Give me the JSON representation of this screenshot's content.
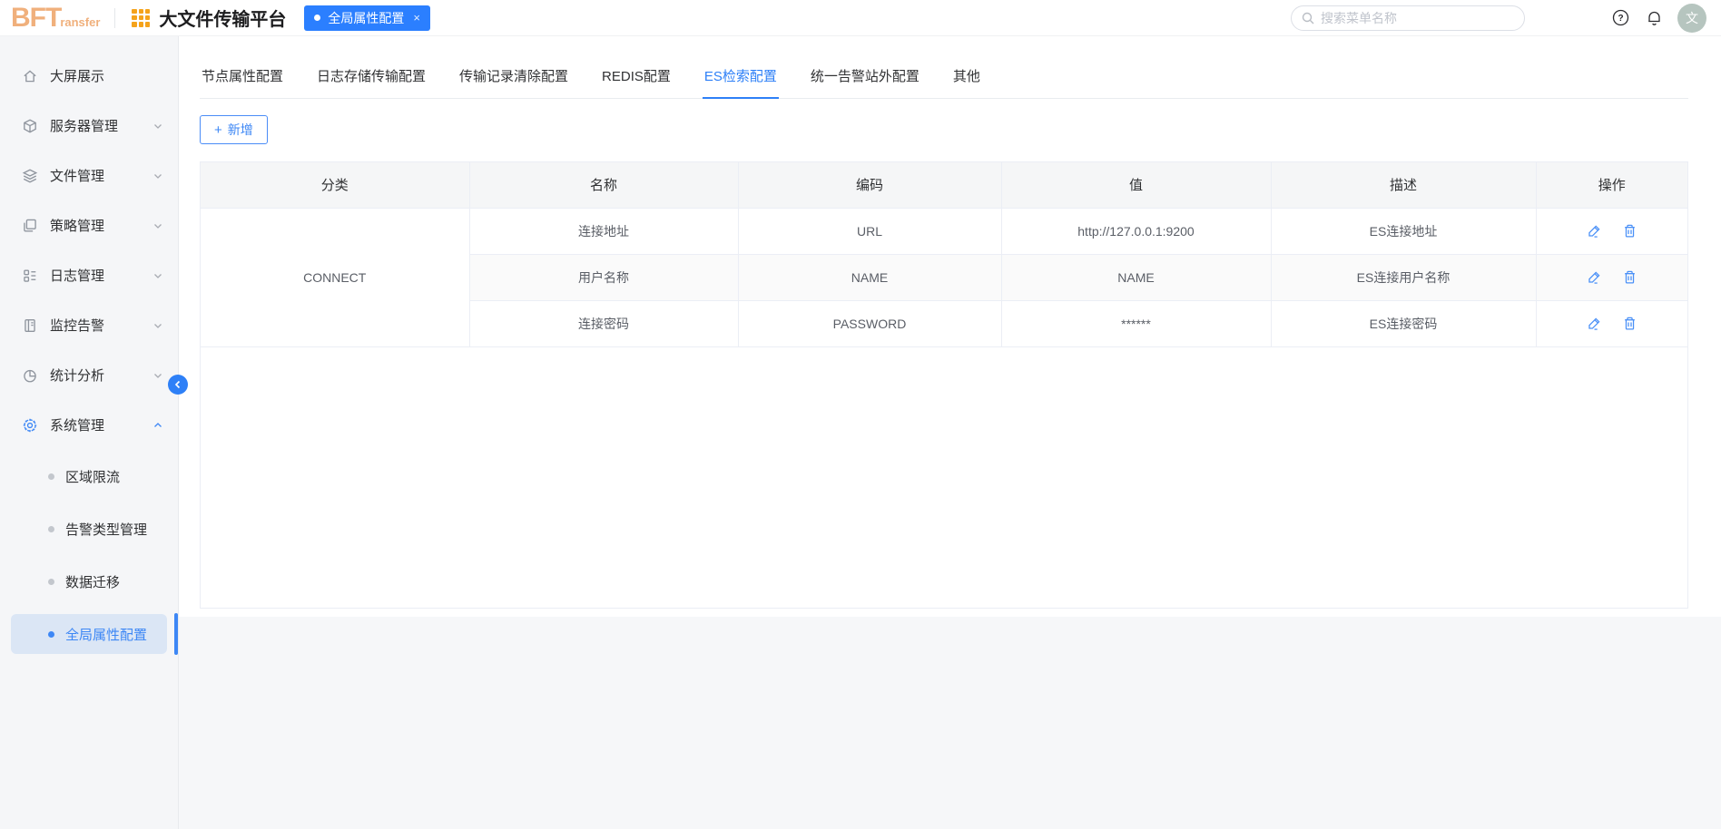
{
  "colors": {
    "primary": "#2E80F7",
    "page_tab_bg": "#2B7FFF",
    "logo_orange": "#F0B07C",
    "grid_orange": "#F5A31B",
    "avatar_bg": "#B6C5BF",
    "active_item_bg": "#DBE6F5"
  },
  "header": {
    "logo_main": "BFT",
    "logo_sub": "ransfer",
    "app_title": "大文件传输平台",
    "page_tab": {
      "label": "全局属性配置",
      "close": "×"
    },
    "search": {
      "placeholder": "搜索菜单名称"
    },
    "avatar": "文"
  },
  "sidebar": {
    "items": [
      {
        "label": "大屏展示"
      },
      {
        "label": "服务器管理"
      },
      {
        "label": "文件管理"
      },
      {
        "label": "策略管理"
      },
      {
        "label": "日志管理"
      },
      {
        "label": "监控告警"
      },
      {
        "label": "统计分析"
      },
      {
        "label": "系统管理"
      }
    ],
    "sub_items": [
      {
        "label": "区域限流"
      },
      {
        "label": "告警类型管理"
      },
      {
        "label": "数据迁移"
      },
      {
        "label": "全局属性配置"
      }
    ]
  },
  "content": {
    "tabs": [
      "节点属性配置",
      "日志存储传输配置",
      "传输记录清除配置",
      "REDIS配置",
      "ES检索配置",
      "统一告警站外配置",
      "其他"
    ],
    "active_tab": "ES检索配置",
    "add_button": {
      "icon": "+",
      "label": "新增"
    },
    "table": {
      "columns": [
        "分类",
        "名称",
        "编码",
        "值",
        "描述",
        "操作"
      ],
      "category": "CONNECT",
      "rows": [
        {
          "name": "连接地址",
          "code": "URL",
          "value": "http://127.0.0.1:9200",
          "desc": "ES连接地址"
        },
        {
          "name": "用户名称",
          "code": "NAME",
          "value": "NAME",
          "desc": "ES连接用户名称"
        },
        {
          "name": "连接密码",
          "code": "PASSWORD",
          "value": "******",
          "desc": "ES连接密码"
        }
      ]
    }
  }
}
